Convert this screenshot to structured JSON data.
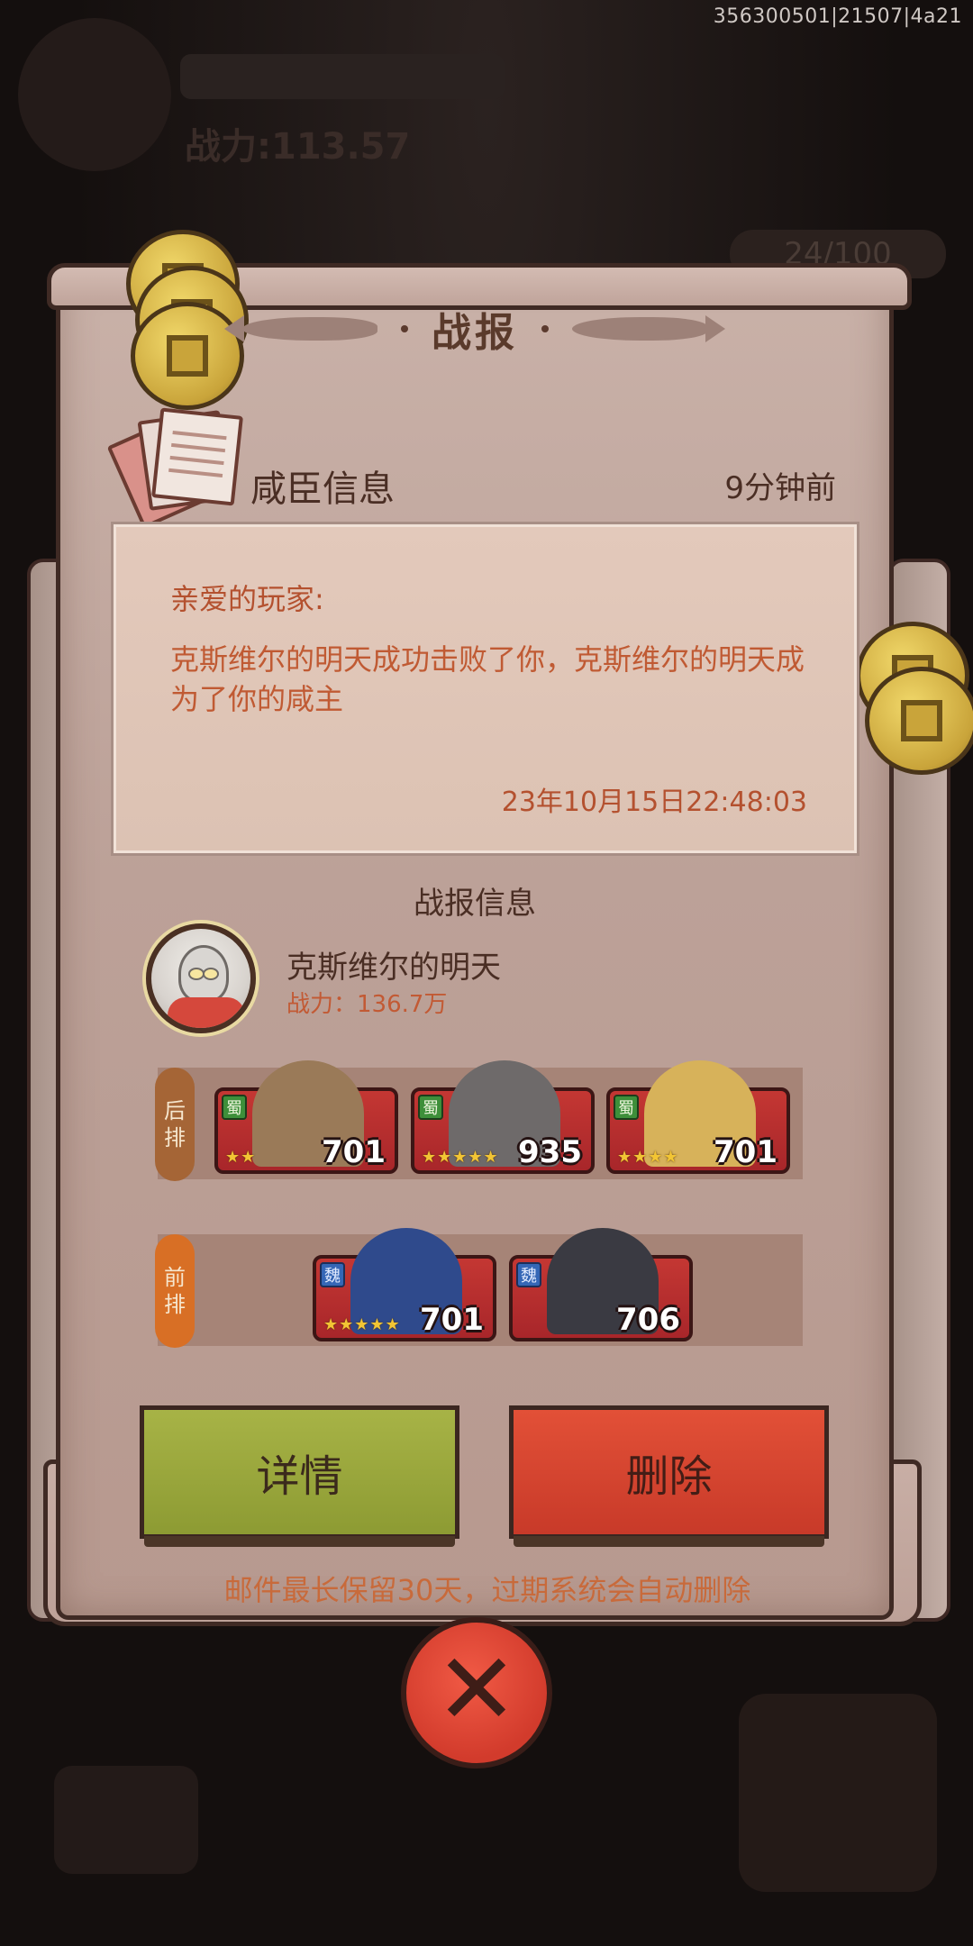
{
  "build_id": "356300501|21507|4a21",
  "background": {
    "power_text": "战力:113.57",
    "resource_counter": "24/100"
  },
  "dialog": {
    "title": "战报",
    "mail": {
      "subject": "咸臣信息",
      "time_ago": "9分钟前",
      "greeting": "亲爱的玩家:",
      "body": "克斯维尔的明天成功击败了你，克斯维尔的明天成为了你的咸主",
      "date": "23年10月15日22:48:03"
    },
    "report": {
      "heading": "战报信息",
      "enemy_name": "克斯维尔的明天",
      "enemy_power": "战力：136.7万",
      "back_row": {
        "label": "后排",
        "heroes": [
          {
            "faction": "蜀",
            "stars": "★★",
            "level": "701"
          },
          {
            "faction": "蜀",
            "stars": "★★★★★",
            "level": "935"
          },
          {
            "faction": "蜀",
            "stars": "★★★★",
            "level": "701"
          }
        ]
      },
      "front_row": {
        "label": "前排",
        "heroes": [
          {
            "faction": "魏",
            "stars": "★★★★★",
            "level": "701"
          },
          {
            "faction": "魏",
            "stars": "",
            "level": "706"
          }
        ]
      }
    },
    "buttons": {
      "detail": "详情",
      "delete": "删除"
    },
    "retention_note": "邮件最长保留30天，过期系统会自动删除"
  },
  "colors": {
    "parchment": "#bca198",
    "detail_button": "#9aa73c",
    "delete_button": "#d8442f",
    "accent_text": "#c05a33"
  },
  "icons": {
    "close": "close-x-icon",
    "mail": "mail-stack-icon",
    "coin": "copper-coin-icon"
  }
}
